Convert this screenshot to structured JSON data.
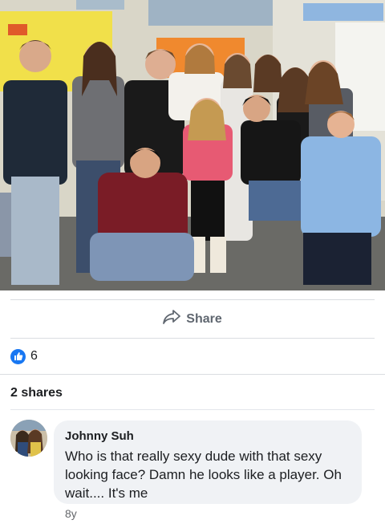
{
  "post": {
    "photo_icon": "group-photo",
    "share_label": "Share",
    "share_icon": "share-arrow-icon"
  },
  "reactions": {
    "icon": "like-thumb-icon",
    "count": "6",
    "accent": "#1877f2"
  },
  "shares": {
    "label": "2 shares"
  },
  "comment": {
    "author": "Johnny Suh",
    "text": "Who is that really sexy dude with that sexy looking face? Damn he looks like a player. Oh wait.... It's me",
    "time": "8y"
  }
}
